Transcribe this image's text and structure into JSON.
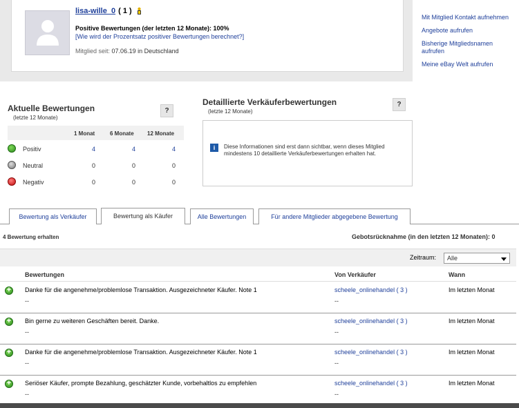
{
  "profile": {
    "username": "lisa-wille_0",
    "count": "( 1 )",
    "positive_text": "Positive Bewertungen (der letzten 12 Monate): 100%",
    "positive_link": "[Wie wird der Prozentsatz positiver Bewertungen berechnet?]",
    "member_label": "Mitglied seit:",
    "member_value": "07.06.19 in Deutschland"
  },
  "side_links": [
    "Mit Mitglied Kontakt aufnehmen",
    "Angebote aufrufen",
    "Bisherige Mitgliedsnamen aufrufen",
    "Meine eBay Welt aufrufen"
  ],
  "current": {
    "title": "Aktuelle Bewertungen",
    "subtitle": "(letzte 12 Monate)",
    "help": "?",
    "columns": [
      "1 Monat",
      "6 Monate",
      "12 Monate"
    ],
    "rows": [
      {
        "label": "Positiv",
        "values": [
          "4",
          "4",
          "4"
        ],
        "icon": "positive-icon",
        "color": "#2e9e1e"
      },
      {
        "label": "Neutral",
        "values": [
          "0",
          "0",
          "0"
        ],
        "icon": "neutral-icon",
        "color": "#8a8a8a"
      },
      {
        "label": "Negativ",
        "values": [
          "0",
          "0",
          "0"
        ],
        "icon": "negative-icon",
        "color": "#d11a1a"
      }
    ]
  },
  "detailed": {
    "title": "Detaillierte Verkäuferbewertungen",
    "subtitle": "(letzte 12 Monate)",
    "help": "?",
    "info_icon": "i",
    "info_text": "Diese Informationen sind erst dann sichtbar, wenn dieses Mitglied mindestens 10 detaillierte Verkäuferbewertungen erhalten hat."
  },
  "tabs": [
    {
      "label": "Bewertung als Verkäufer",
      "active": false
    },
    {
      "label": "Bewertung als Käufer",
      "active": true
    },
    {
      "label": "Alle Bewertungen",
      "active": false
    },
    {
      "label": "Für andere Mitglieder abgegebene Bewertung",
      "active": false
    }
  ],
  "summary": {
    "received": "4 Bewertung erhalten",
    "withdrawals": "Gebotsrücknahme (in den letzten 12 Monaten): 0"
  },
  "filter": {
    "label": "Zeitraum:",
    "selected": "Alle"
  },
  "list_headers": {
    "feedback": "Bewertungen",
    "seller": "Von Verkäufer",
    "when": "Wann"
  },
  "entries": [
    {
      "text": "Danke für die angenehme/problemlose Transaktion. Ausgezeichneter Käufer. Note 1",
      "sub": "--",
      "seller": "scheele_onlinehandel",
      "score": "( 3 )",
      "sub2": "--",
      "when": "Im letzten Monat"
    },
    {
      "text": "Bin gerne zu weiteren Geschäften bereit. Danke.",
      "sub": "--",
      "seller": "scheele_onlinehandel",
      "score": "( 3 )",
      "sub2": "--",
      "when": "Im letzten Monat"
    },
    {
      "text": "Danke für die angenehme/problemlose Transaktion. Ausgezeichneter Käufer. Note 1",
      "sub": "--",
      "seller": "scheele_onlinehandel",
      "score": "( 3 )",
      "sub2": "--",
      "when": "Im letzten Monat"
    },
    {
      "text": "Seriöser Käufer, prompte Bezahlung, geschätzter Kunde, vorbehaltlos zu empfehlen",
      "sub": "--",
      "seller": "scheele_onlinehandel",
      "score": "( 3 )",
      "sub2": "--",
      "when": "Im letzten Monat"
    }
  ]
}
